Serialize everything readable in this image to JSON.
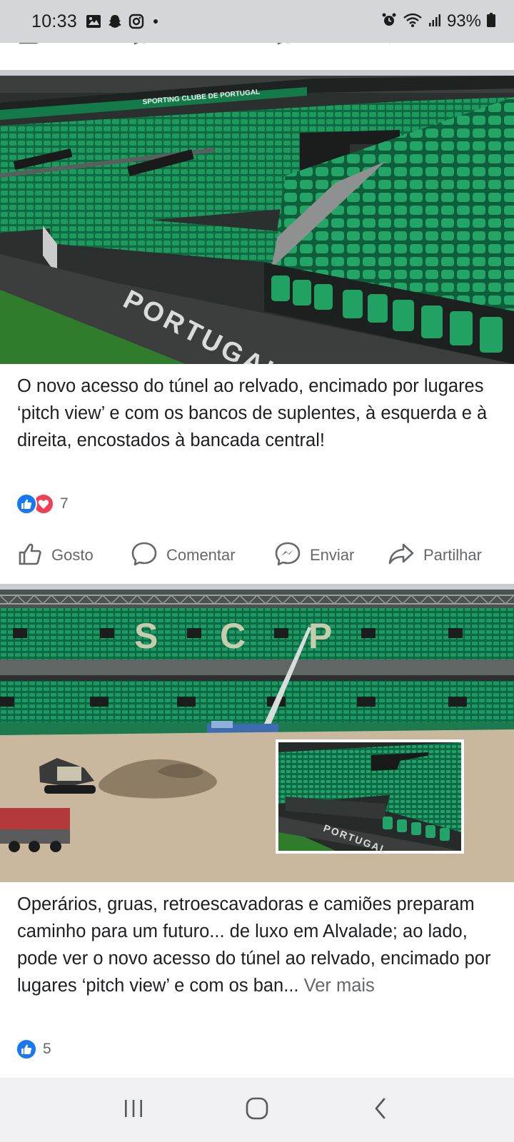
{
  "status_bar": {
    "time": "10:33",
    "battery": "93%",
    "left_icons": [
      "gallery-icon",
      "snapchat-icon",
      "instagram-icon",
      "dot-icon"
    ],
    "right_icons": [
      "alarm-icon",
      "wifi-icon",
      "signal-icon",
      "battery-icon"
    ]
  },
  "actions": {
    "like": "Gosto",
    "comment": "Comentar",
    "send": "Enviar",
    "share": "Partilhar"
  },
  "post1": {
    "photo_text": "PORTUGAL",
    "banner_text": "SPORTING CLUBE DE PORTUGAL",
    "text": "O novo acesso do túnel ao relvado, encimado por lugares ‘pitch view’ e com os bancos de suplentes, à esquerda e à direita, encostados à bancada central!",
    "reaction_count": "7"
  },
  "post2": {
    "photo_letters": [
      "S",
      "C",
      "P"
    ],
    "text": "Operários, gruas, retroescavadoras e camiões preparam caminho para um futuro... de luxo em Alvalade; ao lado, pode ver o novo acesso do túnel ao relvado, encimado por lugares ‘pitch view’ e com os ban...",
    "see_more": "Ver mais",
    "reaction_count": "5"
  },
  "nav": [
    "recent-apps",
    "home",
    "back"
  ],
  "colors": {
    "facebook_blue": "#1877f2",
    "love_red": "#f33e58",
    "seat_green": "#1f8f5a",
    "grey_text": "#65676b"
  }
}
